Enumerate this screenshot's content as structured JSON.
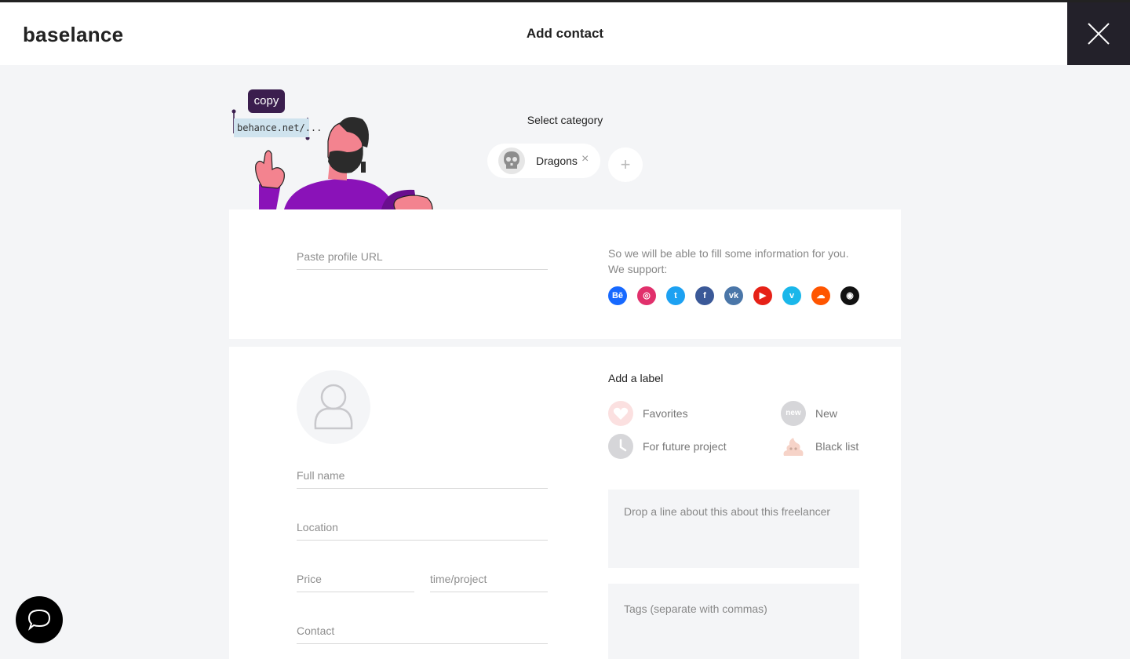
{
  "header": {
    "logo": "baselance",
    "title": "Add contact"
  },
  "illustration": {
    "bubble": "copy",
    "url_snippet": "behance.net/..."
  },
  "category": {
    "label": "Select category",
    "selected": "Dragons",
    "remove_symbol": "×",
    "add_symbol": "+"
  },
  "profile_url": {
    "placeholder": "Paste profile URL",
    "info_line1": "So we will be able to fill some information for you.",
    "info_line2": "We support:",
    "supported": [
      {
        "name": "behance-icon",
        "glyph": "Bē",
        "color": "#1769ff"
      },
      {
        "name": "instagram-icon",
        "glyph": "◎",
        "color": "#e1306c"
      },
      {
        "name": "twitter-icon",
        "glyph": "t",
        "color": "#1da1f2"
      },
      {
        "name": "facebook-icon",
        "glyph": "f",
        "color": "#3b5998"
      },
      {
        "name": "vk-icon",
        "glyph": "vk",
        "color": "#4a76a8"
      },
      {
        "name": "youtube-icon",
        "glyph": "▶",
        "color": "#e62117"
      },
      {
        "name": "vimeo-icon",
        "glyph": "v",
        "color": "#1ab7ea"
      },
      {
        "name": "soundcloud-icon",
        "glyph": "☁",
        "color": "#ff5500"
      },
      {
        "name": "github-icon",
        "glyph": "◉",
        "color": "#111111"
      }
    ]
  },
  "form": {
    "full_name": "Full name",
    "location": "Location",
    "price": "Price",
    "time_project": "time/project",
    "contact": "Contact"
  },
  "labels": {
    "title": "Add a label",
    "favorites": "Favorites",
    "new": "New",
    "new_badge": "new",
    "future": "For future project",
    "blacklist": "Black list"
  },
  "notes": {
    "note_placeholder": "Drop a line about this about this freelancer",
    "tags_placeholder": "Tags (separate with commas)"
  },
  "colors": {
    "close_bg": "#23212a",
    "bubble": "#3b1e4e",
    "favorites": "#f8d4d4",
    "neutral_icon": "#d6d6d9"
  }
}
